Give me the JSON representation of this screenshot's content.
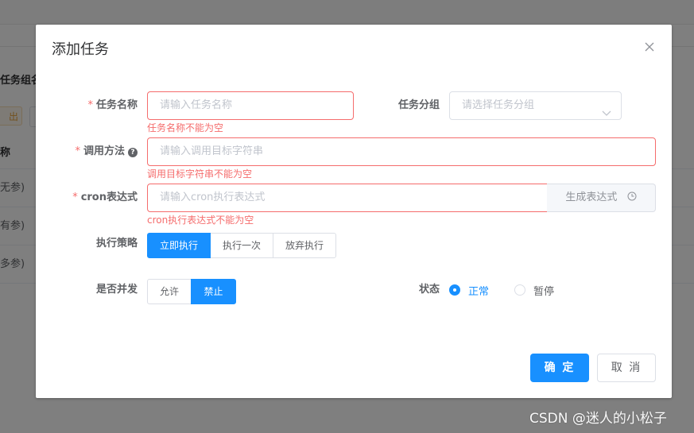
{
  "background": {
    "group_label": "任务组名",
    "export_label": "出",
    "name_column_header": "称",
    "rows": [
      "无参)",
      "有参)",
      "多参)"
    ]
  },
  "dialog": {
    "title": "添加任务",
    "close_icon": "close-icon",
    "form": {
      "task_name": {
        "required_mark": "*",
        "label": "任务名称",
        "placeholder": "请输入任务名称",
        "error": "任务名称不能为空"
      },
      "task_group": {
        "label": "任务分组",
        "placeholder": "请选择任务分组",
        "icon": "chevron-down-icon"
      },
      "invoke_target": {
        "required_mark": "*",
        "label": "调用方法",
        "help_icon": "question-circle-icon",
        "help_glyph": "?",
        "placeholder": "请输入调用目标字符串",
        "error": "调用目标字符串不能为空"
      },
      "cron": {
        "required_mark": "*",
        "label": "cron表达式",
        "placeholder": "请输入cron执行表达式",
        "error": "cron执行表达式不能为空",
        "generate_label": "生成表达式",
        "generate_icon": "clock-icon"
      },
      "misfire_policy": {
        "label": "执行策略",
        "options": [
          "立即执行",
          "执行一次",
          "放弃执行"
        ],
        "selected": "立即执行"
      },
      "concurrent": {
        "label": "是否并发",
        "options": [
          "允许",
          "禁止"
        ],
        "selected": "禁止"
      },
      "status": {
        "label": "状态",
        "options": [
          "正常",
          "暂停"
        ],
        "selected": "正常"
      }
    },
    "footer": {
      "confirm_label": "确 定",
      "cancel_label": "取 消"
    }
  },
  "watermark": "CSDN @迷人的小松子",
  "colors": {
    "primary": "#1890ff",
    "error": "#f56c6c",
    "border": "#dcdfe6",
    "warning": "#e6a23c"
  }
}
